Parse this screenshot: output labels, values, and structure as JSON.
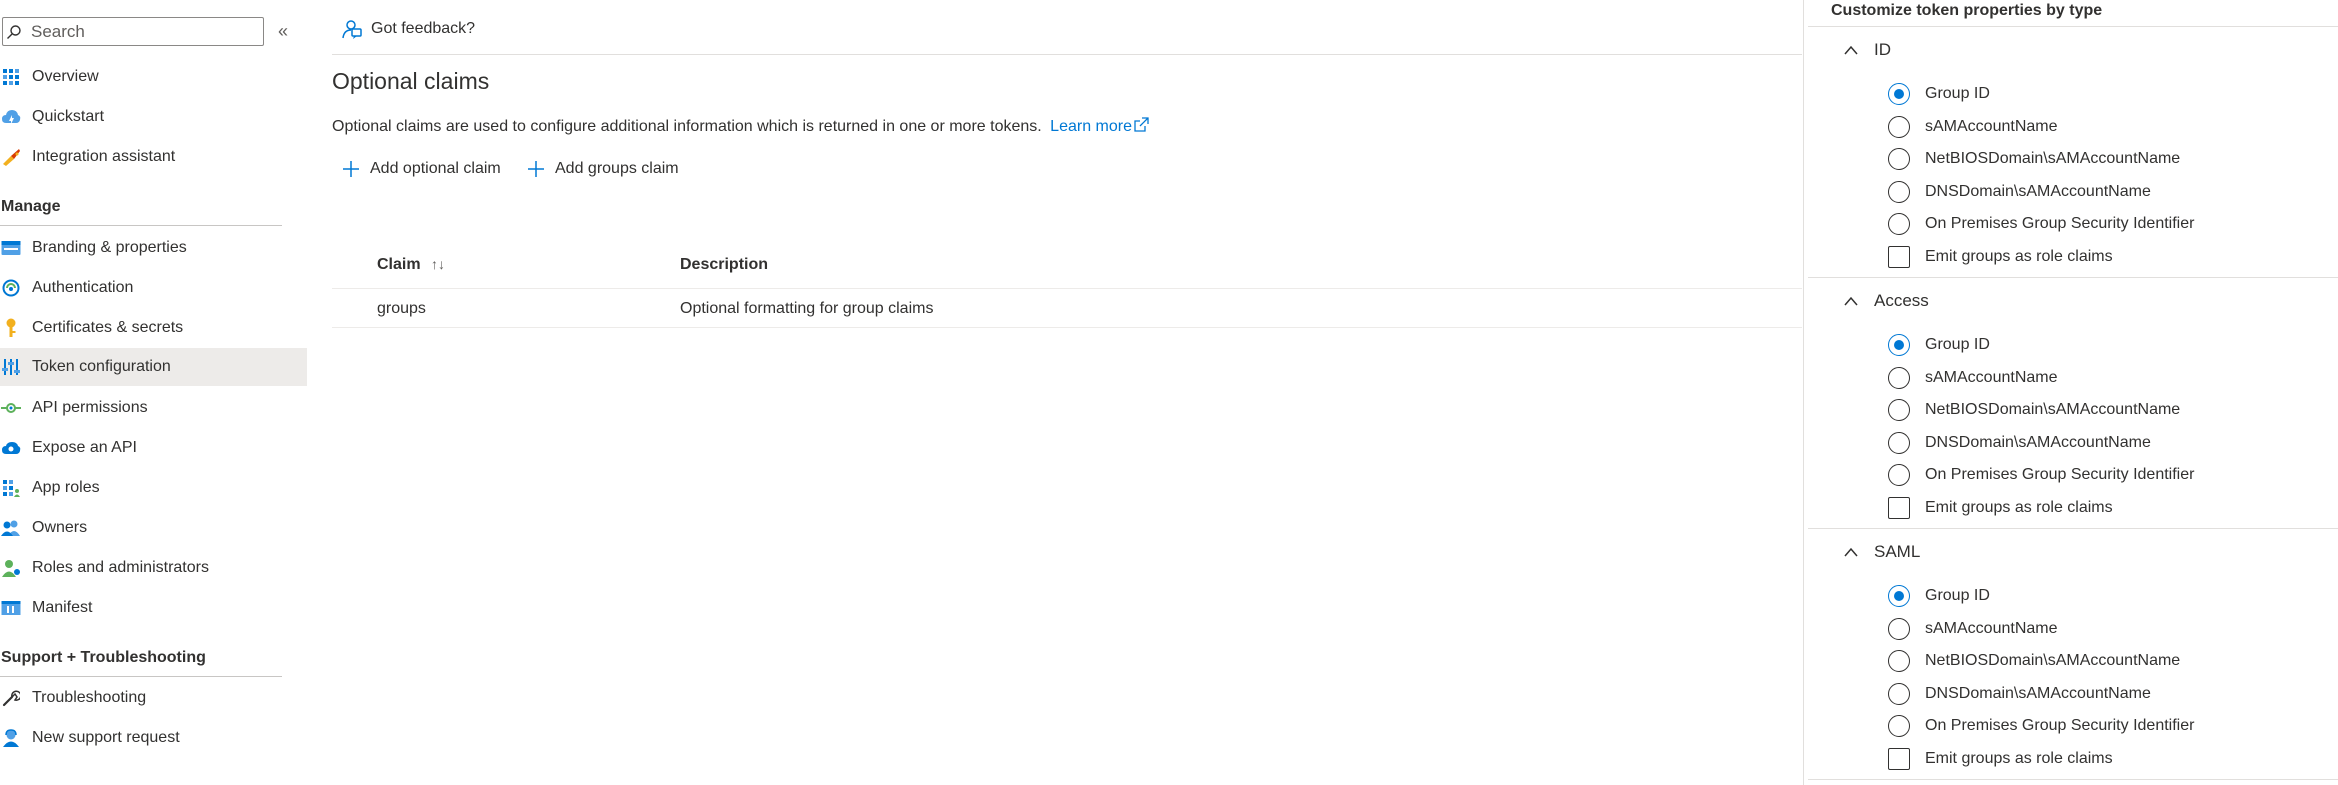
{
  "sidebar": {
    "search_placeholder": "Search",
    "collapse_glyph": "«",
    "items_top": [
      {
        "label": "Overview",
        "icon": "overview-icon"
      },
      {
        "label": "Quickstart",
        "icon": "quickstart-icon"
      },
      {
        "label": "Integration assistant",
        "icon": "integration-assistant-icon"
      }
    ],
    "manage_title": "Manage",
    "manage_items": [
      {
        "label": "Branding & properties",
        "icon": "branding-icon"
      },
      {
        "label": "Authentication",
        "icon": "authentication-icon"
      },
      {
        "label": "Certificates & secrets",
        "icon": "key-icon"
      },
      {
        "label": "Token configuration",
        "icon": "token-configuration-icon",
        "selected": true
      },
      {
        "label": "API permissions",
        "icon": "api-permissions-icon"
      },
      {
        "label": "Expose an API",
        "icon": "expose-api-icon"
      },
      {
        "label": "App roles",
        "icon": "app-roles-icon"
      },
      {
        "label": "Owners",
        "icon": "owners-icon"
      },
      {
        "label": "Roles and administrators",
        "icon": "roles-admins-icon"
      },
      {
        "label": "Manifest",
        "icon": "manifest-icon"
      }
    ],
    "support_title": "Support + Troubleshooting",
    "support_items": [
      {
        "label": "Troubleshooting",
        "icon": "wrench-icon"
      },
      {
        "label": "New support request",
        "icon": "support-request-icon"
      }
    ]
  },
  "main": {
    "feedback_label": "Got feedback?",
    "page_title": "Optional claims",
    "description": "Optional claims are used to configure additional information which is returned in one or more tokens.",
    "learn_more": "Learn more",
    "add_optional_claim": "Add optional claim",
    "add_groups_claim": "Add groups claim",
    "table": {
      "headers": {
        "claim": "Claim",
        "claim_sort": "↑↓",
        "description": "Description"
      },
      "rows": [
        {
          "claim": "groups",
          "description": "Optional formatting for group claims"
        }
      ]
    }
  },
  "panel": {
    "title": "Customize token properties by type",
    "groups": [
      {
        "name": "ID",
        "options": [
          "Group ID",
          "sAMAccountName",
          "NetBIOSDomain\\sAMAccountName",
          "DNSDomain\\sAMAccountName",
          "On Premises Group Security Identifier"
        ],
        "selected": "Group ID",
        "checkbox": "Emit groups as role claims",
        "checkbox_checked": false
      },
      {
        "name": "Access",
        "options": [
          "Group ID",
          "sAMAccountName",
          "NetBIOSDomain\\sAMAccountName",
          "DNSDomain\\sAMAccountName",
          "On Premises Group Security Identifier"
        ],
        "selected": "Group ID",
        "checkbox": "Emit groups as role claims",
        "checkbox_checked": false
      },
      {
        "name": "SAML",
        "options": [
          "Group ID",
          "sAMAccountName",
          "NetBIOSDomain\\sAMAccountName",
          "DNSDomain\\sAMAccountName",
          "On Premises Group Security Identifier"
        ],
        "selected": "Group ID",
        "checkbox": "Emit groups as role claims",
        "checkbox_checked": false
      }
    ]
  },
  "colors": {
    "accent": "#0078d4",
    "text": "#323130",
    "selected_bg": "#edebe9"
  }
}
